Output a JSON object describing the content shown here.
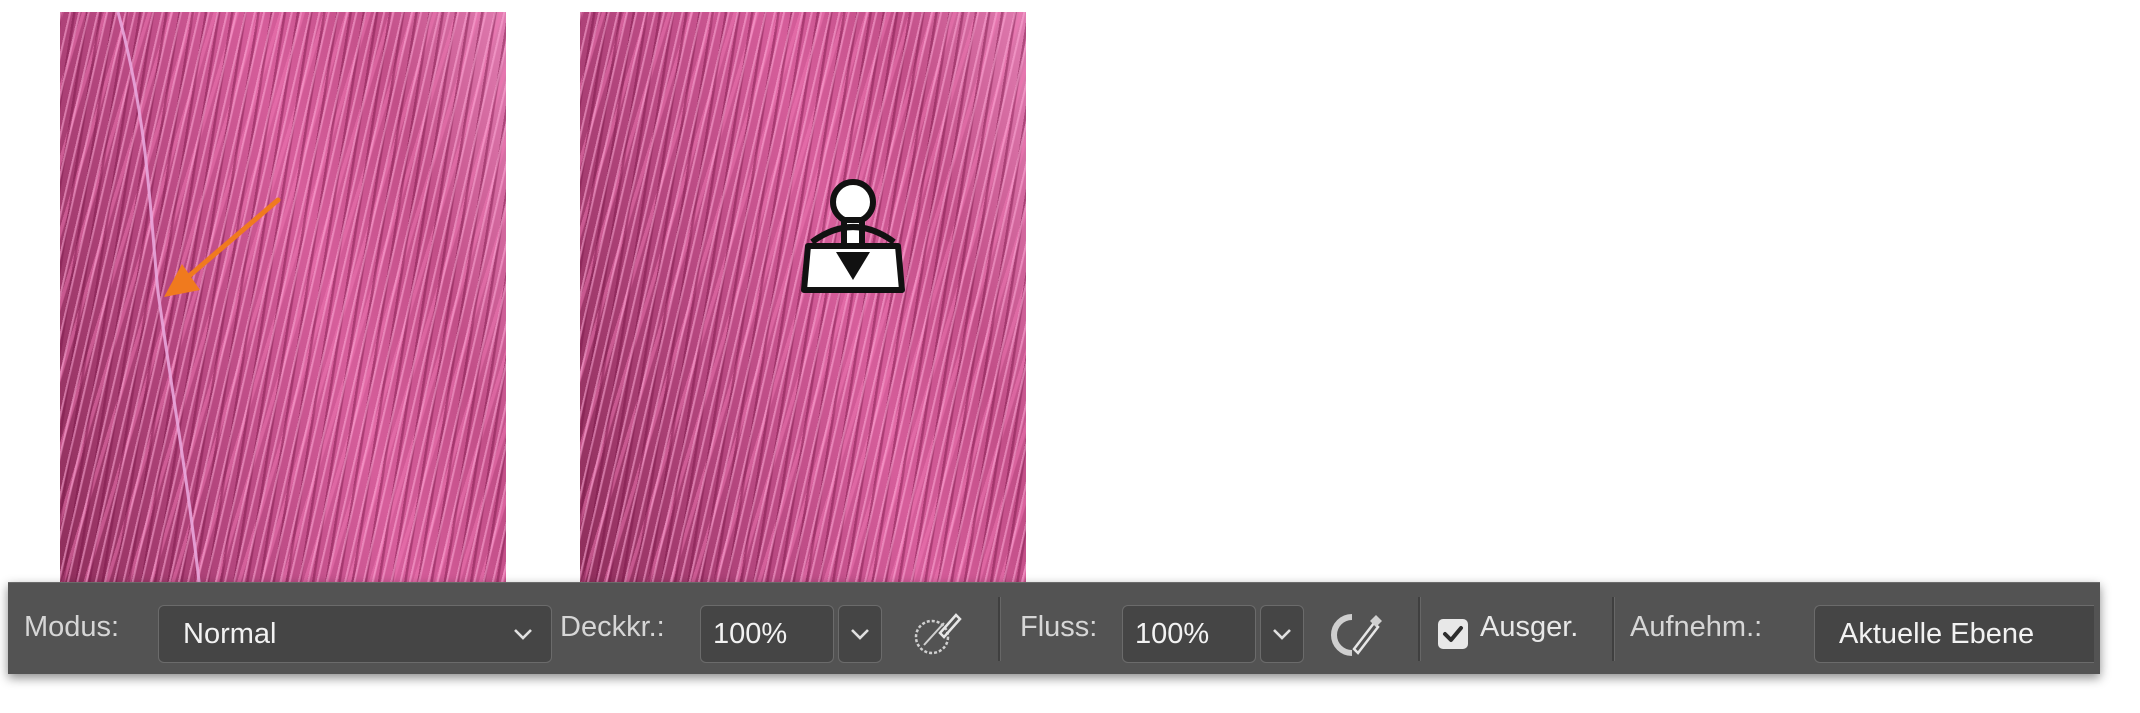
{
  "options_bar": {
    "mode_label": "Modus:",
    "mode_value": "Normal",
    "opacity_label": "Deckkr.:",
    "opacity_value": "100%",
    "flow_label": "Fluss:",
    "flow_value": "100%",
    "aligned_label": "Ausger.",
    "aligned_checked": true,
    "sample_label": "Aufnehm.:",
    "sample_value": "Aktuelle Ebene"
  },
  "icons": {
    "arrow_annotation": "arrow-icon",
    "stamp_cursor": "clone-stamp-cursor-icon",
    "opacity_pressure": "pressure-opacity-icon",
    "airbrush": "airbrush-icon"
  },
  "colors": {
    "annotation_arrow": "#f07a1e",
    "toolbar_bg": "#535353",
    "field_bg": "#454545",
    "hair_base": "#b54a7e"
  }
}
